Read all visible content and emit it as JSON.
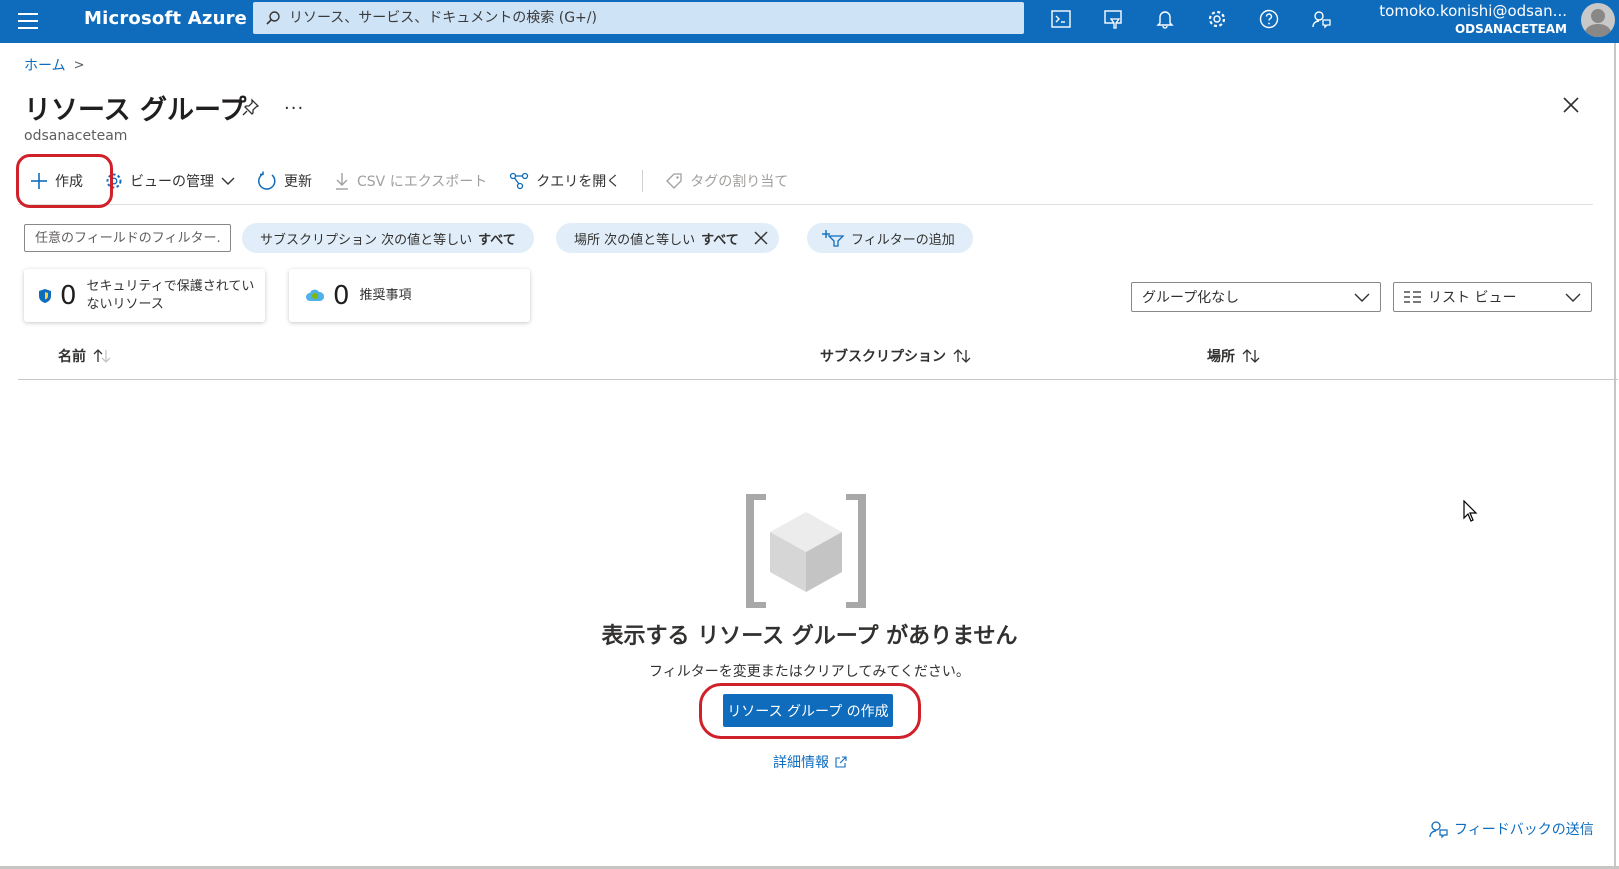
{
  "topbar": {
    "brand": "Microsoft Azure",
    "search_placeholder": "リソース、サービス、ドキュメントの検索 (G+/)",
    "icons": [
      "cloud-shell-icon",
      "directory-filter-icon",
      "notifications-icon",
      "settings-icon",
      "help-icon",
      "feedback-icon"
    ],
    "account_email": "tomoko.konishi@odsan...",
    "account_directory": "ODSANACETEAM",
    "color": "#0f6cbd"
  },
  "breadcrumb": {
    "home": "ホーム",
    "separator": ">"
  },
  "page": {
    "title": "リソース グループ",
    "subtitle": "odsanaceteam",
    "more": "···"
  },
  "toolbar": {
    "create": "作成",
    "manage_view": "ビューの管理",
    "refresh": "更新",
    "export_csv": "CSV にエクスポート",
    "open_query": "クエリを開く",
    "assign_tags": "タグの割り当て"
  },
  "filters": {
    "search_placeholder": "任意のフィールドのフィルター...",
    "subscription_prefix": "サブスクリプション 次の値と等しい",
    "subscription_value": "すべて",
    "location_prefix": "場所 次の値と等しい",
    "location_value": "すべて",
    "add_filter": "フィルターの追加"
  },
  "cards": {
    "security_count": "0",
    "security_label_1": "セキュリティで保護されてい",
    "security_label_2": "ないリソース",
    "recommendations_count": "0",
    "recommendations_label": "推奨事項"
  },
  "views": {
    "grouping": "グループ化なし",
    "view_type": "リスト ビュー"
  },
  "table": {
    "col_name": "名前",
    "col_subscription": "サブスクリプション",
    "col_location": "場所"
  },
  "empty_state": {
    "title": "表示する リソース グループ がありません",
    "subtitle": "フィルターを変更またはクリアしてみてください。",
    "button": "リソース グループ の作成",
    "learn_more": "詳細情報"
  },
  "footer": {
    "feedback": "フィードバックの送信"
  },
  "colors": {
    "accent": "#0f6cbd",
    "annotation": "#d0202a",
    "pill_bg": "#e1eef9"
  }
}
